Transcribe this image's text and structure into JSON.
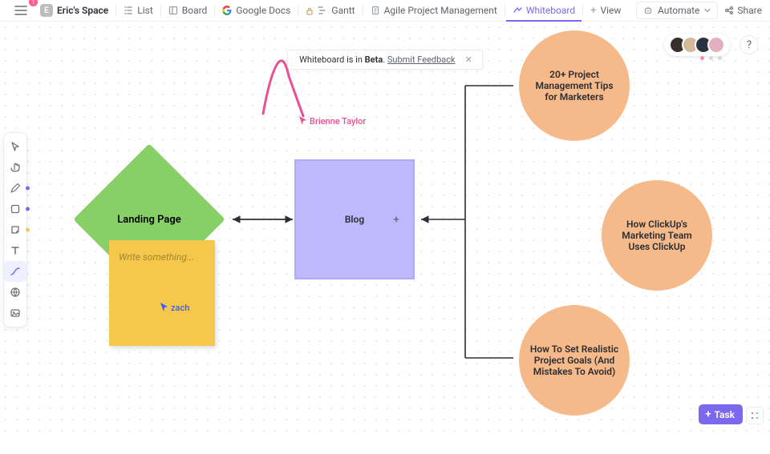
{
  "space": {
    "initial": "E",
    "name": "Eric's Space",
    "notif_count": "1"
  },
  "views": {
    "list": "List",
    "board": "Board",
    "gdocs": "Google Docs",
    "gantt": "Gantt",
    "agile": "Agile Project Management",
    "whiteboard": "Whiteboard",
    "add": "View"
  },
  "topbar": {
    "automate": "Automate",
    "share": "Share"
  },
  "banner": {
    "prefix": "Whiteboard is in ",
    "bold": "Beta",
    "link": "Submit Feedback"
  },
  "nodes": {
    "landing": "Landing Page",
    "blog": "Blog",
    "circle1": "20+ Project Management Tips for Marketers",
    "circle2": "How ClickUp's Marketing Team Uses ClickUp",
    "circle3": "How To Set Realistic Project Goals (And Mistakes To Avoid)"
  },
  "sticky": {
    "placeholder": "Write something..."
  },
  "cursors": {
    "brienne": "Brienne Taylor",
    "zach": "zach"
  },
  "task_button": "Task",
  "help": "?",
  "colors": {
    "brienne": "#e84f95",
    "zach": "#3b5cff",
    "dot_pen": "#6a5bff",
    "dot_shape": "#6a5bff",
    "dot_sticky": "#f5c84c"
  },
  "avatars": [
    "#3a2f2a",
    "#d4b89a",
    "#2a3340",
    "#e2b0bc"
  ]
}
